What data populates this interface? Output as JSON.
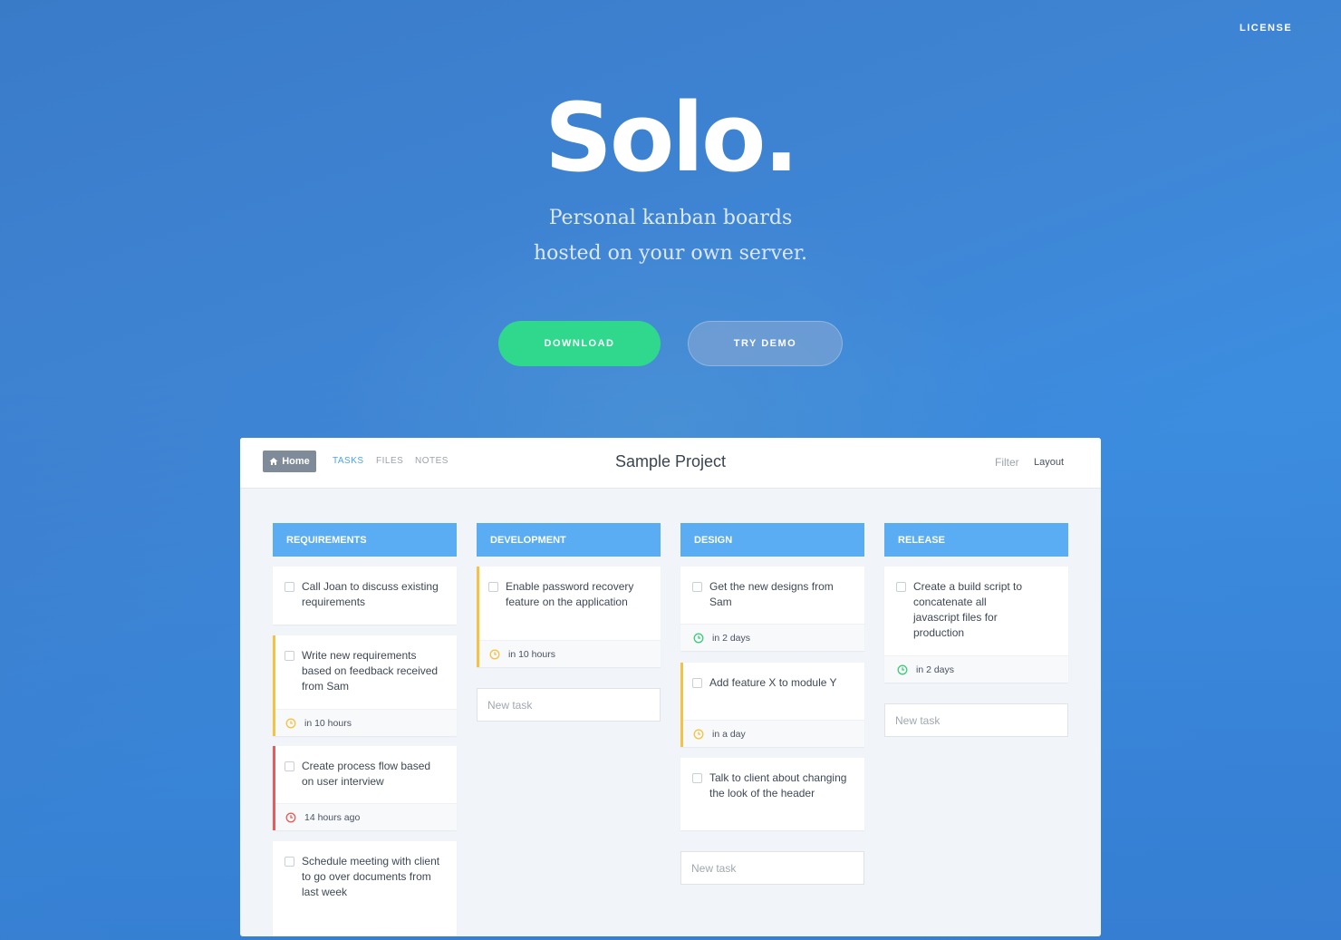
{
  "nav": {
    "license": "LICENSE"
  },
  "hero": {
    "title": "Solo.",
    "tagline_line1": "Personal kanban boards",
    "tagline_line2": "hosted on your own server.",
    "download_label": "DOWNLOAD",
    "demo_label": "TRY DEMO"
  },
  "app": {
    "home_label": "Home",
    "tabs": [
      "TASKS",
      "FILES",
      "NOTES"
    ],
    "project_title": "Sample Project",
    "filter_label": "Filter",
    "layout_label": "Layout",
    "new_task_placeholder": "New task",
    "columns": [
      {
        "title": "REQUIREMENTS",
        "cards": [
          {
            "text": "Call Joan to discuss existing requirements"
          },
          {
            "text": "Write new requirements based on feedback received from Sam",
            "due": "in 10 hours"
          },
          {
            "text": "Create process flow based on user interview",
            "due": "14 hours ago"
          },
          {
            "text": "Schedule meeting with client to go over documents from last week"
          }
        ]
      },
      {
        "title": "DEVELOPMENT",
        "cards": [
          {
            "text": "Enable password recovery feature on the application",
            "due": "in 10 hours"
          }
        ]
      },
      {
        "title": "DESIGN",
        "cards": [
          {
            "text": "Get the new designs from Sam",
            "due": "in 2 days"
          },
          {
            "text": "Add feature X to module Y",
            "due": "in a day"
          },
          {
            "text": "Talk to client about changing the look of the header"
          }
        ]
      },
      {
        "title": "RELEASE",
        "cards": [
          {
            "text": "Create a build script to concatenate all javascript files for production",
            "due": "in 2 days"
          }
        ]
      }
    ]
  },
  "colors": {
    "accent_green": "#2fd88c",
    "column_header": "#5aacf3",
    "due_soon": "#f6c244",
    "overdue": "#ec5b5b",
    "due_ok": "#3dcc7a"
  }
}
